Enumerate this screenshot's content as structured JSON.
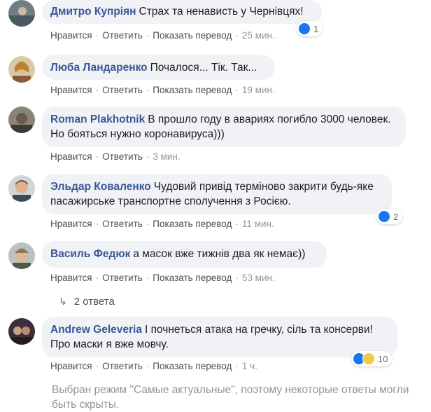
{
  "actions": {
    "like": "Нравится",
    "reply": "Ответить",
    "translate": "Показать перевод",
    "separator": "·"
  },
  "comments": [
    {
      "author": "Дмитро Купріян",
      "text": "Страх та ненависть у Чернівцях!",
      "time": "25 мин.",
      "reactions": "1"
    },
    {
      "author": "Люба Ландаренко",
      "text": "Почалося... Тік. Так...",
      "time": "19 мин."
    },
    {
      "author": "Roman Plakhotnik",
      "text": "В прошло году в авариях погибло 3000 человек. Но бояться нужно коронавируса)))",
      "time": "3 мин."
    },
    {
      "author": "Эльдар Коваленко",
      "text": "Чудовий привід терміново закрити будь-яке пасажирське транспортне сполучення з Росією.",
      "time": "11 мин.",
      "reactions": "2"
    },
    {
      "author": "Василь Федюк",
      "text": "а масок вже тижнів два як немає))",
      "time": "53 мин."
    },
    {
      "author": "Andrew Geleveria",
      "text": "І почнеться атака на гречку, сіль та консерви! Про маски я вже мовчу.",
      "time": "1 ч.",
      "reactions": "10"
    }
  ],
  "replies_toggle": "2 ответа",
  "footnote": "Выбран режим \"Самые актуальные\", поэтому некоторые ответы могли быть скрыты.",
  "colors": {
    "author": "#385898",
    "bubble": "#f0f2f5",
    "meta": "#90949c",
    "like": "#1877f2"
  }
}
